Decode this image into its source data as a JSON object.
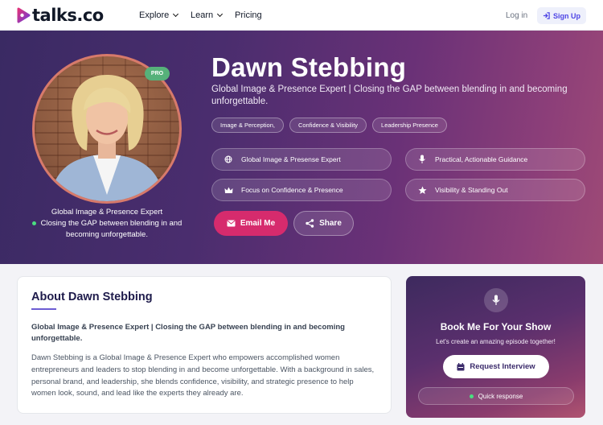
{
  "nav": {
    "brand": "talks.co",
    "links": [
      "Explore",
      "Learn",
      "Pricing"
    ],
    "login": "Log in",
    "signup": "Sign Up"
  },
  "profile": {
    "badge": "PRO",
    "name": "Dawn Stebbing",
    "tagline": "Global Image & Presence Expert | Closing the GAP between blending in and becoming unforgettable.",
    "caption_line1": "Global Image & Presence Expert",
    "caption_line2": "Closing the GAP between blending in and becoming unforgettable.",
    "tags": [
      "Image & Perception,",
      "Confidence & Visibility",
      "Leadership Presence"
    ],
    "features": [
      {
        "label": "Global Image & Presense Expert",
        "icon": "globe-icon"
      },
      {
        "label": "Practical, Actionable Guidance",
        "icon": "mic-icon"
      },
      {
        "label": "Focus on Confidence & Presence",
        "icon": "crown-icon"
      },
      {
        "label": "Visibility & Standing Out",
        "icon": "star-icon"
      }
    ],
    "email_button": "Email Me",
    "share_button": "Share"
  },
  "about": {
    "title": "About Dawn Stebbing",
    "lead": "Global Image & Presence Expert | Closing the GAP between blending in and becoming unforgettable.",
    "body": "Dawn Stebbing is a Global Image & Presence Expert who empowers accomplished women entrepreneurs and leaders to stop blending in and become unforgettable. With a background in sales, personal brand, and leadership, she blends confidence, visibility, and strategic presence to help women look, sound, and lead like the experts they already are."
  },
  "book": {
    "title": "Book Me For Your Show",
    "subtitle": "Let's create an amazing episode together!",
    "request_button": "Request Interview",
    "status": "Quick response"
  },
  "colors": {
    "accent_pink": "#d62b6d",
    "brand_indigo": "#4f46e5",
    "status_green": "#4ade80"
  }
}
